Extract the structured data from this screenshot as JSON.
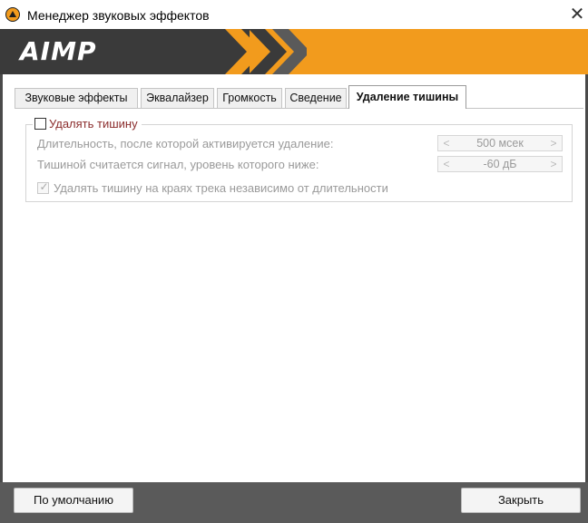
{
  "window": {
    "title": "Менеджер звуковых эффектов",
    "close_glyph": "✕"
  },
  "banner": {
    "logo_text": "AIMP",
    "brand_colors": {
      "orange": "#f29b1d",
      "dark": "#3a3a3a"
    }
  },
  "tabs": [
    {
      "label": "Звуковые эффекты",
      "active": false
    },
    {
      "label": "Эквалайзер",
      "active": false
    },
    {
      "label": "Громкость",
      "active": false
    },
    {
      "label": "Сведение",
      "active": false
    },
    {
      "label": "Удаление тишины",
      "active": true
    }
  ],
  "silence": {
    "enable_label": "Удалять тишину",
    "enable_checked": false,
    "duration_label": "Длительность, после которой активируется удаление:",
    "duration_value": "500 мсек",
    "threshold_label": "Тишиной считается сигнал, уровень которого ниже:",
    "threshold_value": "-60 дБ",
    "edges_label": "Удалять тишину на краях трека независимо от длительности",
    "edges_checked": true,
    "spin_left": "<",
    "spin_right": ">",
    "check_glyph": "✓"
  },
  "footer": {
    "default_button": "По умолчанию",
    "close_button": "Закрыть"
  }
}
